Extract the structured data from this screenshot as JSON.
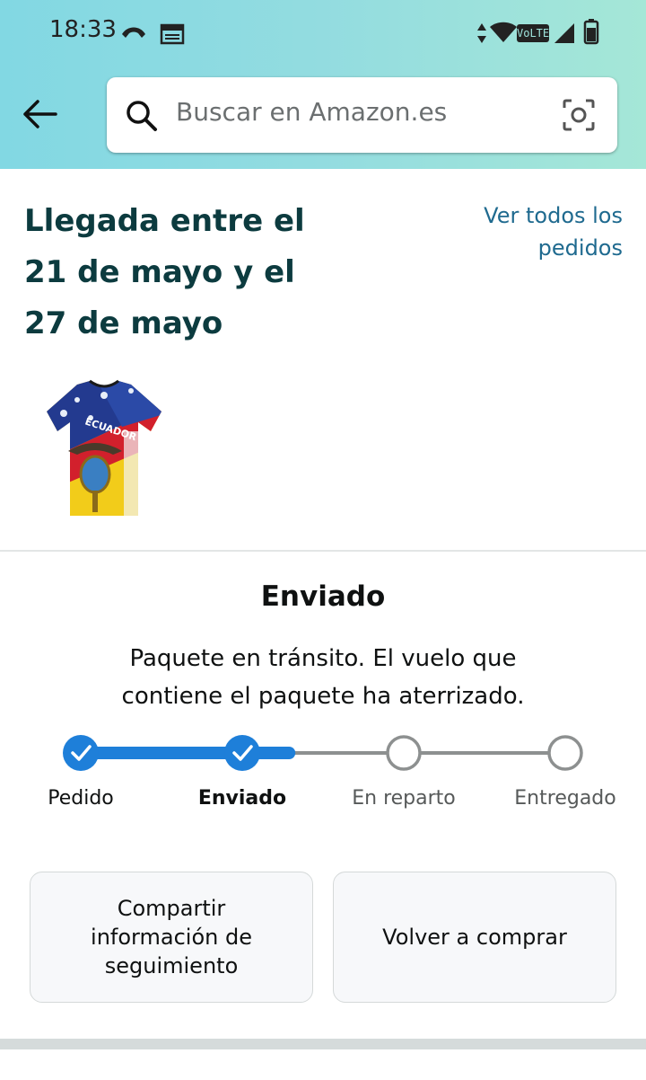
{
  "status_bar": {
    "time": "18:33",
    "network_label": "VoLTE"
  },
  "header": {
    "search_placeholder": "Buscar en Amazon.es",
    "icons": [
      "back-arrow-icon",
      "search-icon",
      "camera-icon"
    ]
  },
  "order": {
    "arrival_line1": "Llegada entre el",
    "arrival_line2": "21 de mayo y el",
    "arrival_line3": "27 de mayo",
    "all_orders_line1": "Ver todos los",
    "all_orders_line2": "pedidos",
    "product_image_text": "ECUADOR"
  },
  "shipment": {
    "title": "Enviado",
    "description_line1": "Paquete en tránsito. El vuelo que",
    "description_line2": "contiene el paquete ha aterrizado.",
    "steps": [
      {
        "label": "Pedido",
        "state": "done"
      },
      {
        "label": "Enviado",
        "state": "current"
      },
      {
        "label": "En reparto",
        "state": "pending"
      },
      {
        "label": "Entregado",
        "state": "pending"
      }
    ],
    "progress_fraction": 0.43
  },
  "actions": {
    "share_line1": "Compartir",
    "share_line2": "información de",
    "share_line3": "seguimiento",
    "buy_again": "Volver a comprar"
  },
  "colors": {
    "accent_blue": "#1e7fd9",
    "pending_gray": "#8d9090",
    "link": "#1f6a8f",
    "heading": "#0c3b3f"
  }
}
